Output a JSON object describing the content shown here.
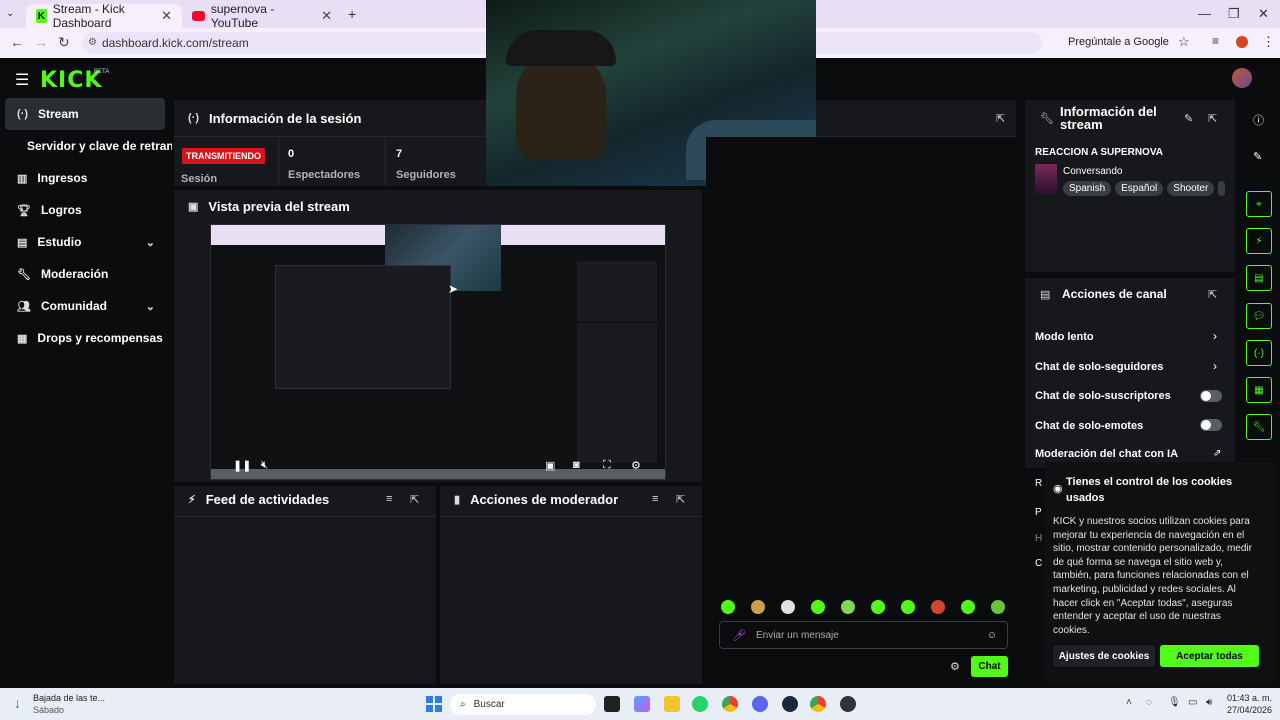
{
  "browser": {
    "tabs": [
      {
        "title": "Stream - Kick Dashboard"
      },
      {
        "title": "supernova - YouTube"
      }
    ],
    "url": "dashboard.kick.com/stream",
    "ask_google": "Pregúntale a Google"
  },
  "brand": {
    "logo": "KICK",
    "beta": "BETA"
  },
  "sidebar": {
    "items": [
      {
        "label": "Stream",
        "icon": "broadcast-icon"
      },
      {
        "label": "Servidor y clave de retransn"
      },
      {
        "label": "Ingresos",
        "icon": "chart-icon"
      },
      {
        "label": "Logros",
        "icon": "trophy-icon"
      },
      {
        "label": "Estudio",
        "icon": "studio-icon"
      },
      {
        "label": "Moderación",
        "icon": "wrench-icon"
      },
      {
        "label": "Comunidad",
        "icon": "community-icon"
      },
      {
        "label": "Drops y recompensas",
        "icon": "drops-icon"
      }
    ]
  },
  "session": {
    "title": "Información de la sesión",
    "status": "TRANSMITIENDO",
    "status_label": "Sesión",
    "viewers": "0",
    "viewers_label": "Espectadores",
    "followers": "7",
    "followers_label": "Seguidores"
  },
  "preview": {
    "title": "Vista previa del stream"
  },
  "feed": {
    "title": "Feed de actividades"
  },
  "mod": {
    "title": "Acciones de moderador"
  },
  "stream_info": {
    "title": "Información del stream",
    "stream_title": "REACCION A SUPERNOVA",
    "category": "Conversando",
    "tags": [
      "Spanish",
      "Español",
      "Shooter"
    ]
  },
  "channel_actions": {
    "title": "Acciones de canal",
    "rows": [
      "Modo lento",
      "Chat de solo-seguidores",
      "Chat de solo-suscriptores",
      "Chat de solo-emotes",
      "Moderación del chat con IA"
    ]
  },
  "chat": {
    "placeholder": "Enviar un mensaje",
    "button": "Chat"
  },
  "cookie": {
    "title": "Tienes el control de los cookies usados",
    "body": "KICK y nuestros socios utilizan cookies para mejorar tu experiencia de navegación en el sitio, mostrar contenido personalizado, medir de qué forma se navega el sitio web y, también, para funciones relacionadas con el marketing, publicidad y redes sociales. Al hacer click en \"Aceptar todas\", aseguras entender y aceptar el uso de nuestras cookies.",
    "settings": "Ajustes de cookies",
    "accept": "Aceptar todas"
  },
  "taskbar": {
    "notification_title": "Bajada de las te...",
    "notification_sub": "Sábado",
    "search": "Buscar",
    "time": "01:43 a. m.",
    "date": "27/04/2026"
  },
  "colors": {
    "accent": "#53fc18",
    "live": "#d7141a"
  }
}
